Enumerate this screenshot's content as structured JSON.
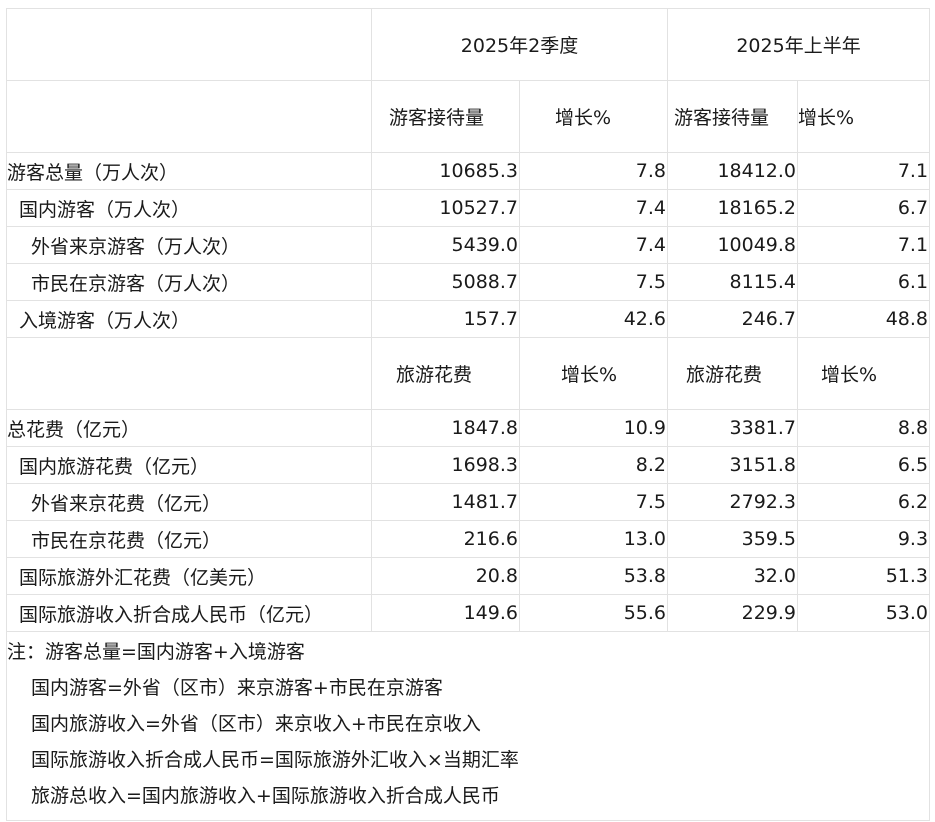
{
  "header": {
    "period_q2": "2025年2季度",
    "period_h1": "2025年上半年"
  },
  "visitor_section": {
    "col_q2_value": "游客接待量",
    "col_q2_growth": "增长%",
    "col_h1_value": "游客接待量",
    "col_h1_growth": "增长%",
    "rows": [
      {
        "label": "游客总量（万人次）",
        "q2": "10685.3",
        "q2_growth": "7.8",
        "h1": "18412.0",
        "h1_growth": "7.1"
      },
      {
        "label": "国内游客（万人次）",
        "q2": "10527.7",
        "q2_growth": "7.4",
        "h1": "18165.2",
        "h1_growth": "6.7"
      },
      {
        "label": "外省来京游客（万人次）",
        "q2": "5439.0",
        "q2_growth": "7.4",
        "h1": "10049.8",
        "h1_growth": "7.1"
      },
      {
        "label": "市民在京游客（万人次）",
        "q2": "5088.7",
        "q2_growth": "7.5",
        "h1": "8115.4",
        "h1_growth": "6.1"
      },
      {
        "label": "入境游客（万人次）",
        "q2": "157.7",
        "q2_growth": "42.6",
        "h1": "246.7",
        "h1_growth": "48.8"
      }
    ]
  },
  "spending_section": {
    "col_q2_value": "旅游花费",
    "col_q2_growth": "增长%",
    "col_h1_value": "旅游花费",
    "col_h1_growth": "增长%",
    "rows": [
      {
        "label": "总花费（亿元）",
        "q2": "1847.8",
        "q2_growth": "10.9",
        "h1": "3381.7",
        "h1_growth": "8.8"
      },
      {
        "label": "国内旅游花费（亿元）",
        "q2": "1698.3",
        "q2_growth": "8.2",
        "h1": "3151.8",
        "h1_growth": "6.5"
      },
      {
        "label": "外省来京花费（亿元）",
        "q2": "1481.7",
        "q2_growth": "7.5",
        "h1": "2792.3",
        "h1_growth": "6.2"
      },
      {
        "label": "市民在京花费（亿元）",
        "q2": "216.6",
        "q2_growth": "13.0",
        "h1": "359.5",
        "h1_growth": "9.3"
      },
      {
        "label": "国际旅游外汇花费（亿美元）",
        "q2": "20.8",
        "q2_growth": "53.8",
        "h1": "32.0",
        "h1_growth": "51.3"
      },
      {
        "label": "国际旅游收入折合成人民币（亿元）",
        "q2": "149.6",
        "q2_growth": "55.6",
        "h1": "229.9",
        "h1_growth": "53.0"
      }
    ]
  },
  "notes": [
    "注：游客总量=国内游客+入境游客",
    "国内游客=外省（区市）来京游客+市民在京游客",
    "国内旅游收入=外省（区市）来京收入+市民在京收入",
    "国际旅游收入折合成人民币=国际旅游外汇收入×当期汇率",
    "旅游总收入=国内旅游收入+国际旅游收入折合成人民币"
  ]
}
